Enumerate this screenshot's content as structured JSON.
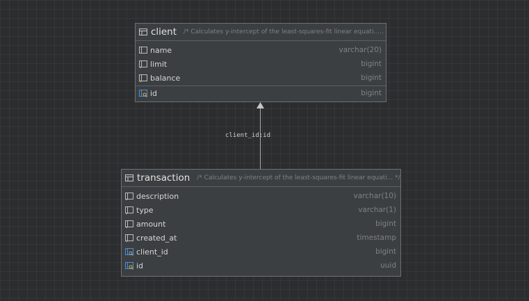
{
  "tables": [
    {
      "name": "client",
      "comment": "/* Calculates y-intercept of the least-squares-fit linear equati... */",
      "columns": [
        {
          "name": "name",
          "type": "varchar(20)",
          "key": false
        },
        {
          "name": "limit",
          "type": "bigint",
          "key": false
        },
        {
          "name": "balance",
          "type": "bigint",
          "key": false
        }
      ],
      "keys": [
        {
          "name": "id",
          "type": "bigint",
          "key": true
        }
      ]
    },
    {
      "name": "transaction",
      "comment": "/* Calculates y-intercept of the least-squares-fit linear equati... */",
      "columns": [
        {
          "name": "description",
          "type": "varchar(10)",
          "key": false
        },
        {
          "name": "type",
          "type": "varchar(1)",
          "key": false
        },
        {
          "name": "amount",
          "type": "bigint",
          "key": false
        },
        {
          "name": "created_at",
          "type": "timestamp",
          "key": false
        },
        {
          "name": "client_id",
          "type": "bigint",
          "key": true
        },
        {
          "name": "id",
          "type": "uuid",
          "key": true
        }
      ]
    }
  ],
  "relation": {
    "label": "client_id:id"
  },
  "colors": {
    "background": "#2b2d2e",
    "table": "#3c3f41",
    "key_icon": "#4a8fd8"
  }
}
